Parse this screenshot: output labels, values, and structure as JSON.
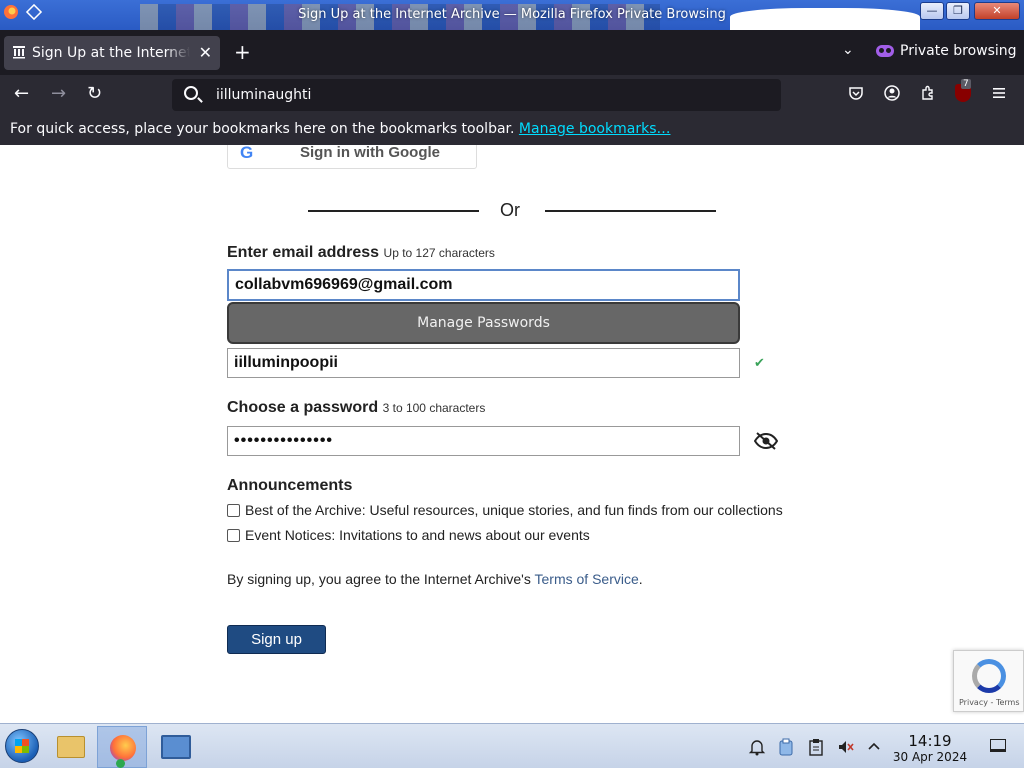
{
  "window": {
    "title": "Sign Up at the Internet Archive — Mozilla Firefox Private Browsing",
    "min_label": "—",
    "max_label": "❐",
    "close_label": "✕"
  },
  "tabs": {
    "active_tab_label": "Sign Up at the Internet Archive",
    "new_tab_label": "+",
    "list_all_label": "⌄",
    "private_label": "Private browsing"
  },
  "navbar": {
    "back_label": "←",
    "forward_label": "→",
    "reload_label": "↻",
    "url_value": "iilluminaughti",
    "ublock_count": "7",
    "icons": [
      "pocket-icon",
      "account-icon",
      "extensions-icon",
      "ublock-icon",
      "menu-icon"
    ]
  },
  "bookmarks": {
    "message": "For quick access, place your bookmarks here on the bookmarks toolbar.",
    "link": "Manage bookmarks…"
  },
  "form": {
    "google_button": "Sign in with Google",
    "or_text": "Or",
    "email_label": "Enter email address",
    "email_hint": "Up to 127 characters",
    "email_value": "collabvm696969@gmail.com",
    "manage_passwords": "Manage Passwords",
    "username_value": "iilluminpoopii",
    "check_mark": "✔",
    "password_label": "Choose a password",
    "password_hint": "3 to 100 characters",
    "password_masked": "•••••••••••••••",
    "announcements_title": "Announcements",
    "options": [
      {
        "label": "Best of the Archive: Useful resources, unique stories, and fun finds from our collections",
        "checked": false
      },
      {
        "label": "Event Notices: Invitations to and news about our events",
        "checked": false
      }
    ],
    "terms_prefix": "By signing up, you agree to the Internet Archive's",
    "terms_link": "Terms of Service",
    "terms_suffix": ".",
    "signup_button": "Sign up",
    "recaptcha_links": "Privacy - Terms"
  },
  "taskbar": {
    "time": "14:19",
    "date": "30 Apr 2024"
  }
}
